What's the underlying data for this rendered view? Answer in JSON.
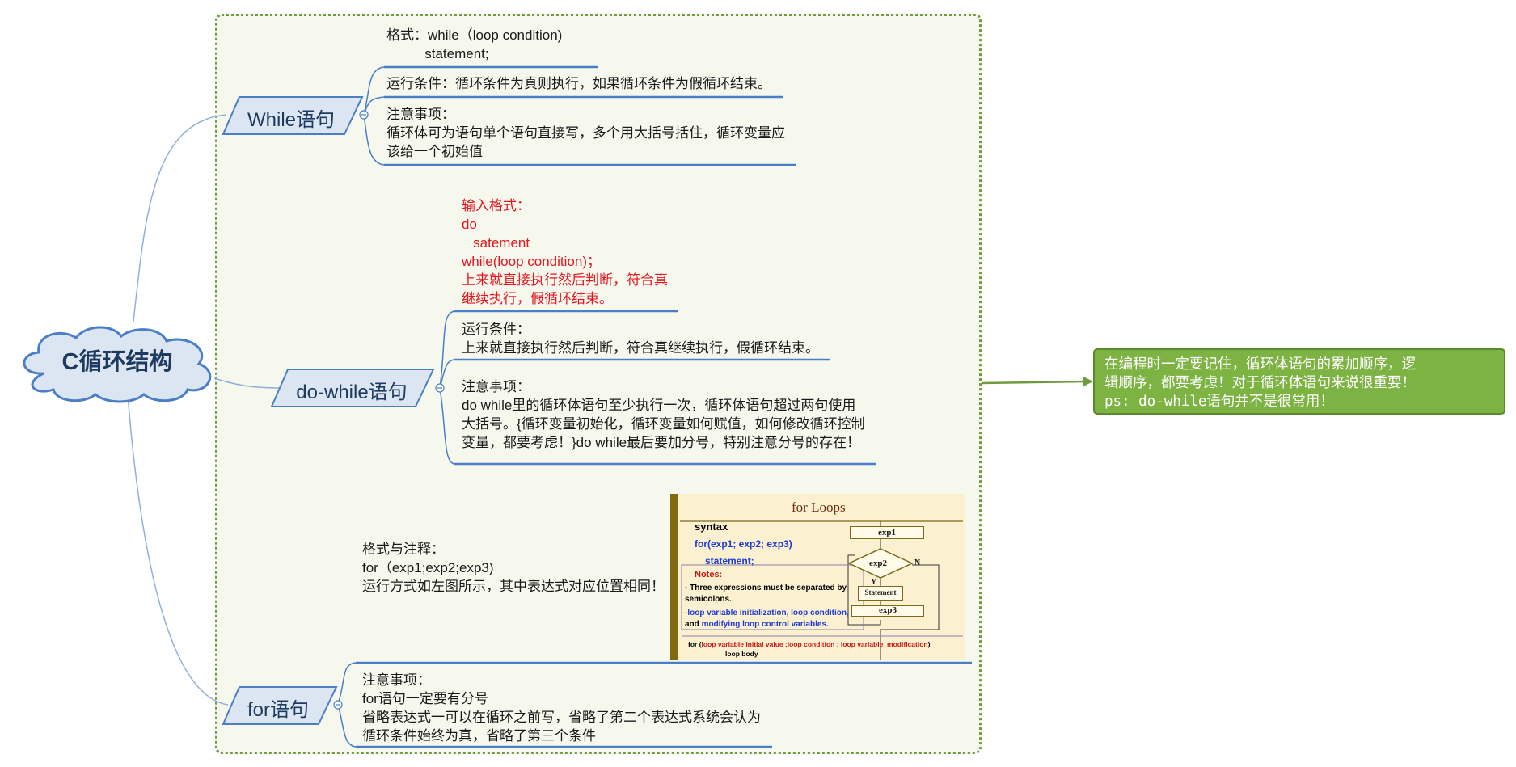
{
  "root": {
    "label": "C循环结构"
  },
  "while": {
    "label": "While语句",
    "format": "格式：while（loop condition)\n          statement;",
    "condition": "运行条件：循环条件为真则执行，如果循环条件为假循环结束。",
    "notes": "注意事项：\n循环体可为语句单个语句直接写，多个用大括号括住，循环变量应\n该给一个初始值"
  },
  "do_while": {
    "label": "do-while语句",
    "format": "输入格式：\ndo\n   satement\nwhile(loop condition)；\n上来就直接执行然后判断，符合真\n继续执行，假循环结束。",
    "condition": "运行条件：\n上来就直接执行然后判断，符合真继续执行，假循环结束。",
    "notes": "注意事项：\ndo while里的循环体语句至少执行一次，循环体语句超过两句使用\n大括号。{循环变量初始化，循环变量如何赋值，如何修改循环控制\n变量，都要考虑！}do while最后要加分号，特别注意分号的存在！"
  },
  "for": {
    "label": "for语句",
    "format": "格式与注释：\nfor（exp1;exp2;exp3)\n运行方式如左图所示，其中表达式对应位置相同！",
    "notes": "注意事项：\nfor语句一定要有分号\n省略表达式一可以在循环之前写，省略了第二个表达式系统会认为\n循环条件始终为真，省略了第三个条件",
    "figure": {
      "title": "for Loops",
      "syntax": "syntax",
      "code1": "for(exp1; exp2; exp3)",
      "code2": "statement;",
      "notes_title": "Notes:",
      "note1": "· Three expressions must be separated by",
      "note1b": "semicolons.",
      "note2a": "-loop variable initialization, loop condition,",
      "note2b_pre": "and ",
      "note2b": "modifying loop control variables.",
      "bottom_pre": "for (",
      "bottom_red": "loop variable initial value ;loop condition ; loop variable  modification",
      "bottom_post": ")",
      "loop_body": "loop body",
      "box_exp1": "exp1",
      "box_exp2": "exp2",
      "box_stmt": "Statement",
      "box_exp3": "exp3",
      "label_y": "Y",
      "label_n": "N"
    }
  },
  "summary_note": "在编程时一定要记住，循环体语句的累加顺序，逻\n辑顺序，都要考虑！对于循环体语句来说很重要！\nps: do-while语句并不是很常用！",
  "colors": {
    "branch_line": "#4a7ec7",
    "branch_fill": "#dce6f2",
    "note_fill": "#7cb342",
    "boundary": "#6f9a3e"
  }
}
